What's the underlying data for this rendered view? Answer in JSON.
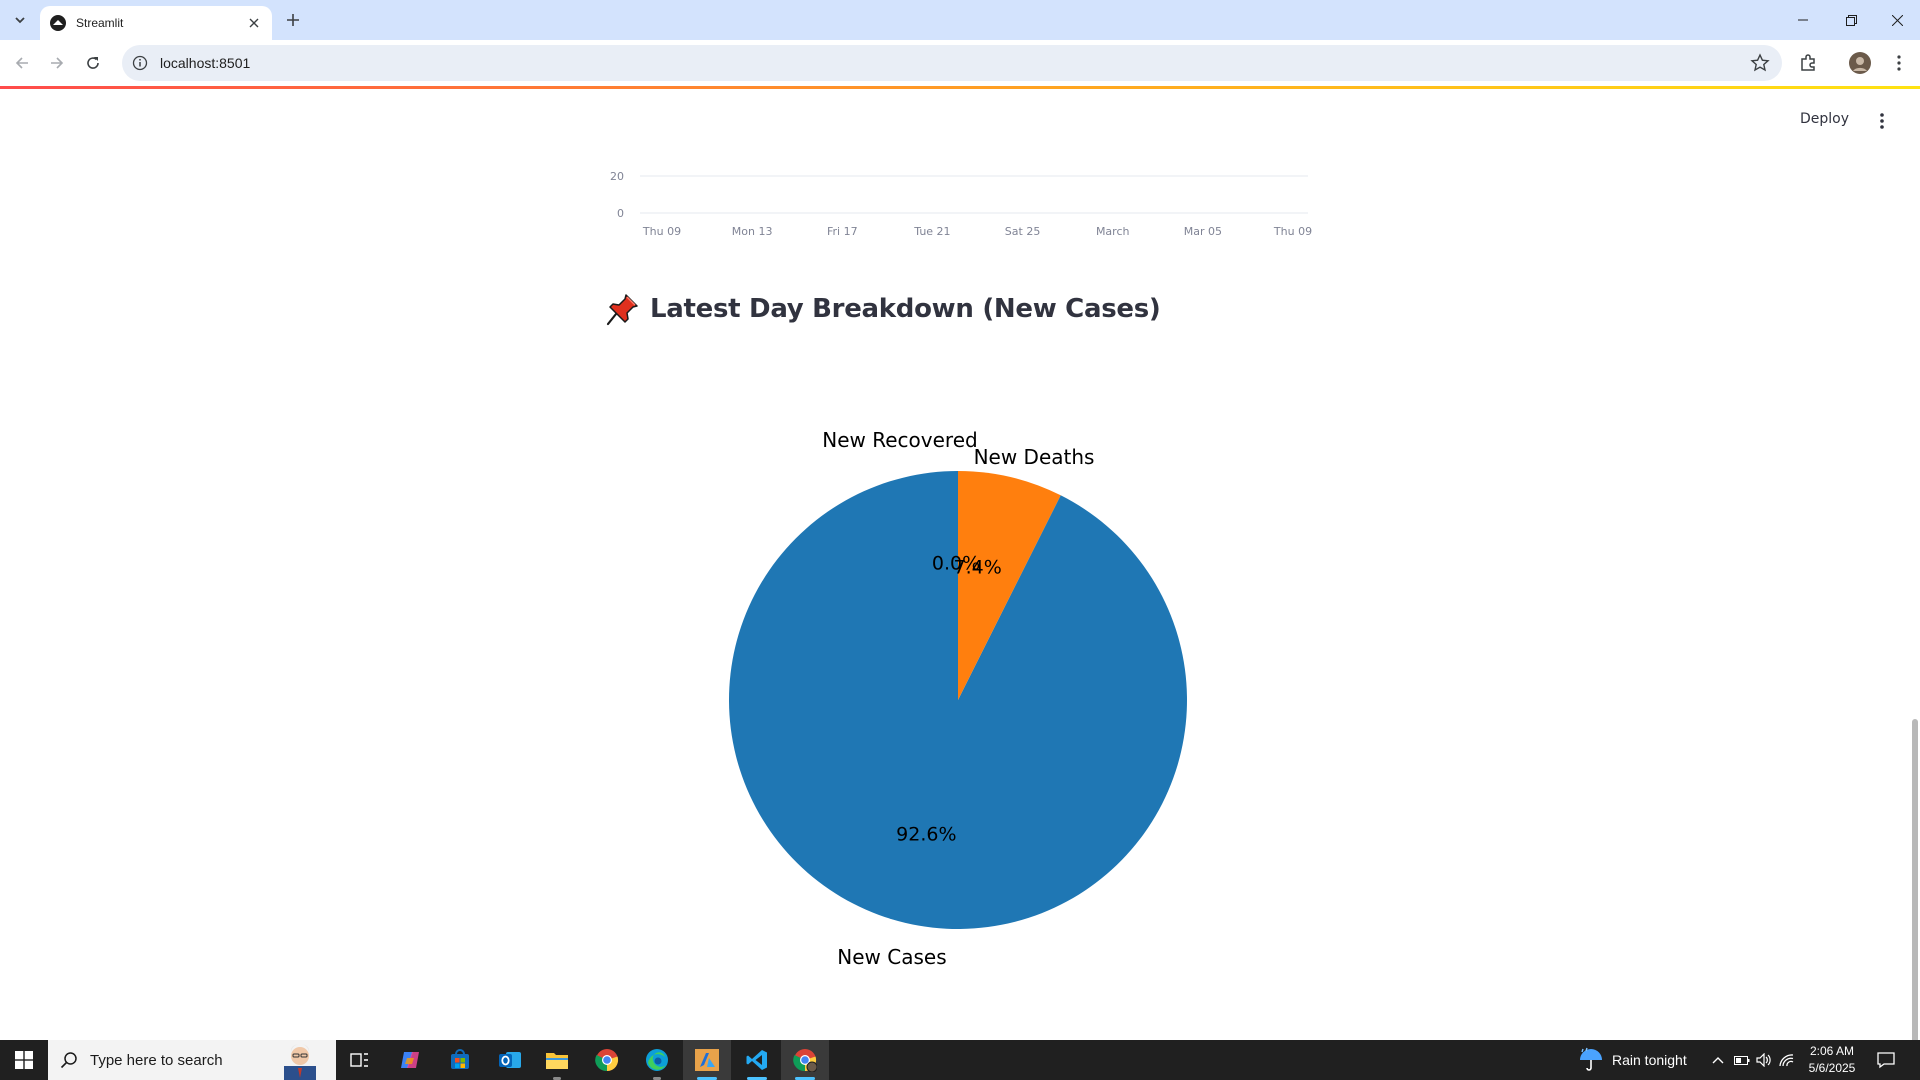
{
  "browser": {
    "tab_title": "Streamlit",
    "url": "localhost:8501"
  },
  "app": {
    "deploy_label": "Deploy",
    "heading": "Latest Day Breakdown (New Cases)",
    "heading_icon": "pushpin-icon"
  },
  "chart_data": [
    {
      "type": "line",
      "title": "",
      "xlabel": "",
      "ylabel": "",
      "x_tick_labels": [
        "Thu 09",
        "Mon 13",
        "Fri 17",
        "Tue 21",
        "Sat 25",
        "March",
        "Mar 05",
        "Thu 09"
      ],
      "y_tick_labels": [
        "20",
        "0"
      ],
      "note_visible_portion": "only the bottom of the chart (0 to 20 range) is visible in the viewport"
    },
    {
      "type": "pie",
      "title": "",
      "categories": [
        "New Cases",
        "New Deaths",
        "New Recovered"
      ],
      "values": [
        92.6,
        7.4,
        0.0
      ],
      "value_labels": [
        "92.6%",
        "7.4%",
        "0.0%"
      ],
      "colors": [
        "#1f77b4",
        "#ff7f0e",
        "#2ca02c"
      ],
      "start_angle_deg": 90,
      "direction": "counterclockwise"
    }
  ],
  "taskbar": {
    "search_placeholder": "Type here to search",
    "weather_text": "Rain tonight",
    "time": "2:06 AM",
    "date": "5/6/2025",
    "apps": [
      "task-view-icon",
      "copilot-icon",
      "store-icon",
      "outlook-icon",
      "file-explorer-icon",
      "chrome-icon",
      "edge-icon",
      "azure-icon",
      "vscode-icon",
      "chrome-profile-icon"
    ]
  }
}
